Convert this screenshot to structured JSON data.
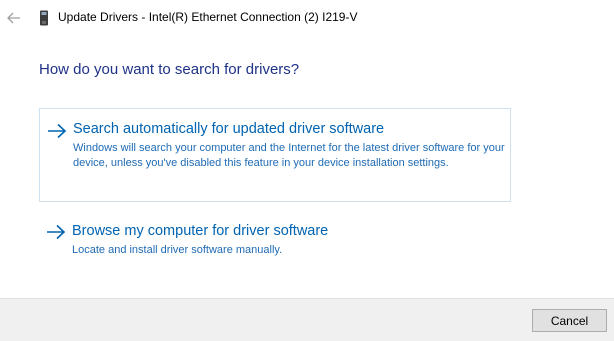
{
  "window": {
    "title": "Update Drivers - Intel(R) Ethernet Connection (2) I219-V",
    "back_icon": "back-arrow-icon",
    "title_icon": "device-manager-icon"
  },
  "heading": "How do you want to search for drivers?",
  "options": [
    {
      "icon": "right-arrow-icon",
      "title": "Search automatically for updated driver software",
      "description": "Windows will search your computer and the Internet for the latest driver software for your device, unless you've disabled this feature in your device installation settings.",
      "selected": true
    },
    {
      "icon": "right-arrow-icon",
      "title": "Browse my computer for driver software",
      "description": "Locate and install driver software manually.",
      "selected": false
    }
  ],
  "footer": {
    "cancel_label": "Cancel"
  },
  "colors": {
    "heading": "#1e3287",
    "link": "#0063b1",
    "description": "#1f6bb4",
    "selection_border": "#cfe1ef",
    "footer_bg": "#f0f0f0"
  }
}
